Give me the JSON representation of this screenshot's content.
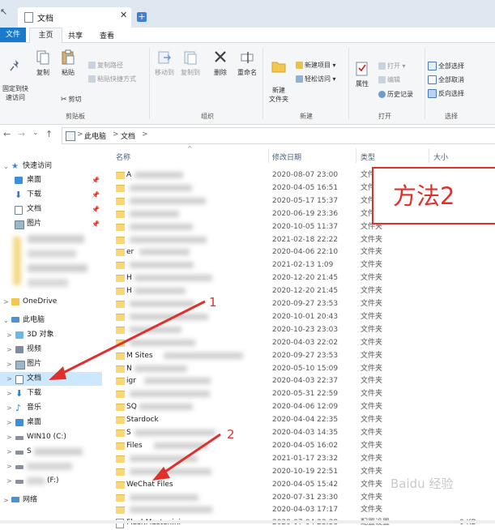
{
  "window": {
    "tab_title": "文档",
    "tab_close": "✕",
    "new_tab": "+"
  },
  "menu": {
    "file": "文件",
    "home": "主页",
    "share": "共享",
    "view": "查看"
  },
  "ribbon": {
    "pin_quick_access": "固定到快\n速访问",
    "copy": "复制",
    "paste": "粘贴",
    "copy_path": "复制路径",
    "paste_shortcut": "粘贴快捷方式",
    "cut": "剪切",
    "clipboard_group": "剪贴板",
    "move_to": "移动到",
    "copy_to": "复制到",
    "delete": "删除",
    "rename": "重命名",
    "organize_group": "组织",
    "new_folder": "新建\n文件夹",
    "new_item": "新建项目 ▾",
    "easy_access": "轻松访问 ▾",
    "new_group": "新建",
    "properties": "属性",
    "open": "打开 ▾",
    "edit": "编辑",
    "history": "历史记录",
    "open_group": "打开",
    "select_all": "全部选择",
    "select_none": "全部取消",
    "invert_selection": "反向选择",
    "select_group": "选择"
  },
  "address": {
    "back": "←",
    "forward": "→",
    "dropdown": "⌄",
    "up": "↑",
    "crumbs": [
      ">",
      "此电脑",
      ">",
      "文档",
      ">"
    ]
  },
  "navigation": {
    "quick_access": "快速访问",
    "desktop": "桌面",
    "downloads": "下载",
    "documents": "文档",
    "pictures": "图片",
    "onedrive": "OneDrive",
    "this_pc": "此电脑",
    "objects3d": "3D 对象",
    "videos": "视频",
    "pictures2": "图片",
    "documents2": "文档",
    "downloads2": "下载",
    "music": "音乐",
    "desktop2": "桌面",
    "drive_c": "WIN10 (C:)",
    "drive_d": "S",
    "drive_f": "(F:)",
    "network": "网络",
    "pin": "📌",
    "expand": ">",
    "collapse": "⌄"
  },
  "filelist": {
    "sort_glyph": "^",
    "col_name": "名称",
    "col_date": "修改日期",
    "col_type": "类型",
    "col_size": "大小",
    "rows": [
      {
        "name": "A",
        "date": "2020-08-07 23:00",
        "type": "文件夹",
        "size": ""
      },
      {
        "name": "",
        "date": "2020-04-05 16:51",
        "type": "文件夹",
        "size": ""
      },
      {
        "name": "",
        "date": "2020-05-17 15:37",
        "type": "文件夹",
        "size": ""
      },
      {
        "name": "",
        "date": "2020-06-19 23:36",
        "type": "文件夹",
        "size": ""
      },
      {
        "name": "",
        "date": "2020-10-05 11:37",
        "type": "文件夹",
        "size": ""
      },
      {
        "name": "",
        "date": "2021-02-18 22:22",
        "type": "文件夹",
        "size": ""
      },
      {
        "name": "er",
        "date": "2020-04-06 22:10",
        "type": "文件夹",
        "size": ""
      },
      {
        "name": "",
        "date": "2021-02-13 1:09",
        "type": "文件夹",
        "size": ""
      },
      {
        "name": "H",
        "date": "2020-12-20 21:45",
        "type": "文件夹",
        "size": ""
      },
      {
        "name": "H",
        "date": "2020-12-20 21:45",
        "type": "文件夹",
        "size": ""
      },
      {
        "name": "",
        "date": "2020-09-27 23:53",
        "type": "文件夹",
        "size": ""
      },
      {
        "name": "",
        "date": "2020-10-01 20:43",
        "type": "文件夹",
        "size": ""
      },
      {
        "name": "",
        "date": "2020-10-23 23:03",
        "type": "文件夹",
        "size": ""
      },
      {
        "name": "",
        "date": "2020-04-03 22:02",
        "type": "文件夹",
        "size": ""
      },
      {
        "name": "M Sites",
        "date": "2020-09-27 23:53",
        "type": "文件夹",
        "size": ""
      },
      {
        "name": "N",
        "date": "2020-05-10 15:09",
        "type": "文件夹",
        "size": ""
      },
      {
        "name": "igr",
        "date": "2020-04-03 22:37",
        "type": "文件夹",
        "size": ""
      },
      {
        "name": "",
        "date": "2020-05-31 22:59",
        "type": "文件夹",
        "size": ""
      },
      {
        "name": "SQ",
        "date": "2020-04-06 12:09",
        "type": "文件夹",
        "size": ""
      },
      {
        "name": "Stardock",
        "date": "2020-04-04 22:35",
        "type": "文件夹",
        "size": ""
      },
      {
        "name": "S",
        "date": "2020-04-03 14:35",
        "type": "文件夹",
        "size": ""
      },
      {
        "name": "Files",
        "date": "2020-04-05 16:02",
        "type": "文件夹",
        "size": ""
      },
      {
        "name": "",
        "date": "2021-01-17 23:32",
        "type": "文件夹",
        "size": ""
      },
      {
        "name": "",
        "date": "2020-10-19 22:51",
        "type": "文件夹",
        "size": ""
      },
      {
        "name": "WeChat Files",
        "date": "2020-04-05 15:42",
        "type": "文件夹",
        "size": ""
      },
      {
        "name": "",
        "date": "2020-07-31 23:30",
        "type": "文件夹",
        "size": ""
      },
      {
        "name": "",
        "date": "2020-04-03 17:17",
        "type": "文件夹",
        "size": ""
      },
      {
        "name": "FlashMaster.ini",
        "date": "2020-07-04 23:38",
        "type": "配置设置",
        "size": "0 KB"
      }
    ]
  },
  "annotations": {
    "method_label": "方法2",
    "arrow1_label": "1",
    "arrow2_label": "2",
    "watermark": "Baidu 经验"
  },
  "colors": {
    "accent": "#1979ca",
    "annotation_red": "#e0302b",
    "selection": "#cce8ff",
    "folder": "#f8d775"
  }
}
